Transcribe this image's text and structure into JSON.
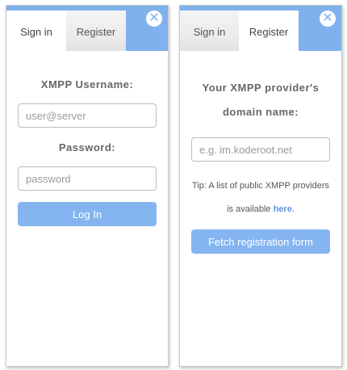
{
  "colors": {
    "accent": "#7fb1ec",
    "button": "#84b5f0",
    "link": "#5e95e0"
  },
  "login_panel": {
    "tabs": [
      {
        "label": "Sign in",
        "active": true
      },
      {
        "label": "Register",
        "active": false
      }
    ],
    "close_icon": "close-icon",
    "username_label": "XMPP Username:",
    "username_placeholder": "user@server",
    "password_label": "Password:",
    "password_placeholder": "password",
    "submit_label": "Log In"
  },
  "register_panel": {
    "tabs": [
      {
        "label": "Sign in",
        "active": false
      },
      {
        "label": "Register",
        "active": true
      }
    ],
    "close_icon": "close-icon",
    "domain_label": "Your XMPP provider's domain name:",
    "domain_placeholder": "e.g. im.koderoot.net",
    "tip_text": "Tip: A list of public XMPP providers is available ",
    "tip_link": "here",
    "tip_end": ".",
    "submit_label": "Fetch registration form"
  }
}
